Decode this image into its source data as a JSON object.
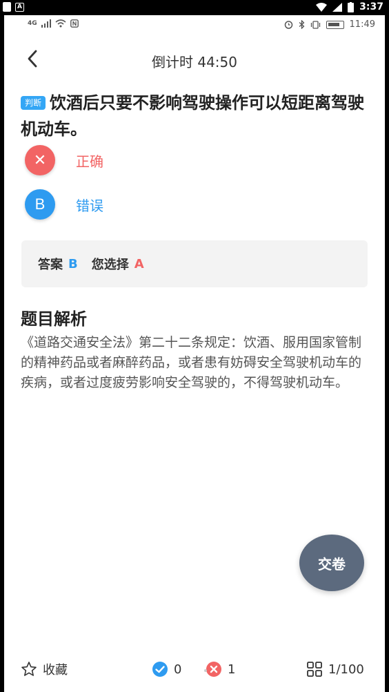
{
  "outer_status": {
    "time": "3:37"
  },
  "inner_status": {
    "network": "4G",
    "time": "11:49"
  },
  "header": {
    "timer": "倒计时 44:50"
  },
  "question": {
    "tag": "判断",
    "text": "饮酒后只要不影响驾驶操作可以短距离驾驶机动车。"
  },
  "options": [
    {
      "mark": "✕",
      "label": "正确",
      "color": "#f26464"
    },
    {
      "mark": "B",
      "label": "错误",
      "color": "#2e9bf0"
    }
  ],
  "answer": {
    "answer_label": "答案",
    "answer_value": "B",
    "chosen_label": "您选择",
    "chosen_value": "A"
  },
  "analysis": {
    "title": "题目解析",
    "text": "《道路交通安全法》第二十二条规定：饮酒、服用国家管制的精神药品或者麻醉药品，或者患有妨碍安全驾驶机动车的疾病，或者过度疲劳影响安全驾驶的，不得驾驶机动车。"
  },
  "submit": {
    "label": "交卷"
  },
  "bottom": {
    "favorite_label": "收藏",
    "correct_count": "0",
    "wrong_count": "1",
    "progress": "1/100"
  }
}
